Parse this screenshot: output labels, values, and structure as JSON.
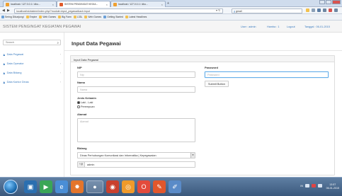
{
  "browser": {
    "tabs": [
      {
        "label": "localhost / 127.0.0.1 / dbu...",
        "favicon_color": "#f0a030"
      },
      {
        "label": "SISTEM PENGINGAT KEGIA...",
        "favicon_color": "#e05a2a"
      },
      {
        "label": "localhost / 127.0.0.1 / dbu...",
        "favicon_color": "#f0a030"
      }
    ],
    "new_tab_label": "+",
    "url": "localhost/sk/sistem/index.php/?module=input_pegawai&act=input",
    "search_value": "gmail",
    "bookmarks": [
      "Sering Dikunjungi",
      "Empire",
      "Web Games",
      "Big Farm",
      "L33L",
      "Web Games",
      "Getting Started",
      "Latest Headlines"
    ]
  },
  "app": {
    "brand": "SISTEM PENGINGAT KEGIATAN PEGAWAI",
    "user_text": "User : admin",
    "role_text": "Hamba : 1",
    "logout_label": "Logout",
    "date_text": "Tanggal : 06-01-2015"
  },
  "sidebar": {
    "search_placeholder": "Search",
    "items": [
      {
        "label": "Data Pegawai"
      },
      {
        "label": "Data Operator"
      },
      {
        "label": "Data Bidang"
      },
      {
        "label": "Data Kantor Dinas"
      }
    ]
  },
  "main": {
    "page_title": "Input Data Pegawai",
    "panel_title": "Input Data Pegawai",
    "nip_label": "NIP",
    "nip_placeholder": "Nip",
    "nama_label": "Nama",
    "nama_placeholder": "Nama",
    "jk_label": "Jenis Kelamin",
    "jk_options": [
      "Laki - Laki",
      "Perempuan"
    ],
    "jk_selected": 0,
    "alamat_label": "Alamat",
    "alamat_placeholder": "Alamat",
    "bidang_label": "Bidang",
    "bidang_value": "Dinas Perhubungan Komunikasi dan Informatika | Kepegawaian",
    "admin_addon": "+@",
    "admin_value": "admin",
    "password_label": "Password",
    "password_placeholder": "Password",
    "submit_label": "Submit Button"
  },
  "taskbar": {
    "tray_lang": "IN",
    "clock_time": "13:57",
    "clock_date": "06-01-2015"
  },
  "colors": {
    "accent": "#3a7bbf",
    "focus_border": "#66afe9",
    "taskbar": "#3a587c"
  }
}
